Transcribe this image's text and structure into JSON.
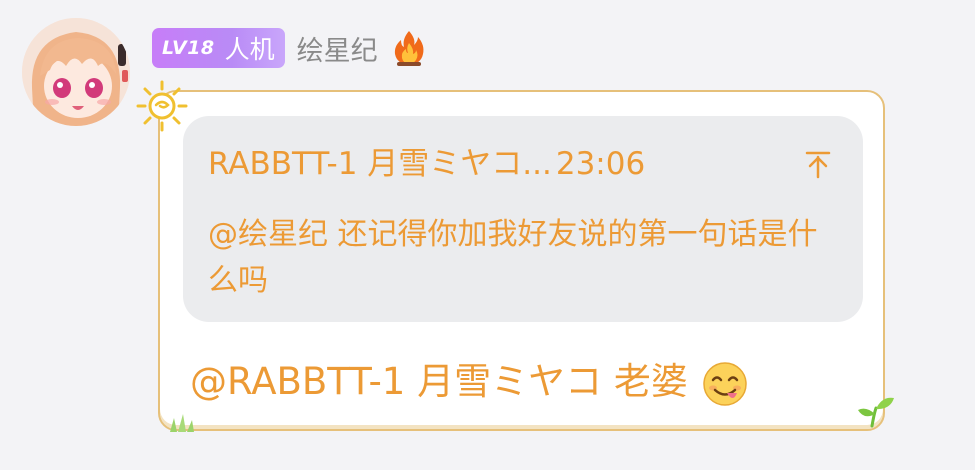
{
  "sender": {
    "level": "LV18",
    "role_badge": "人机",
    "nickname": "绘星纪",
    "flame_emoji": "🔥"
  },
  "reply_quote": {
    "author": "RABBTT-1 月雪ミヤコ...",
    "time": "23:06",
    "text": "@绘星纪 还记得你加我好友说的第一句话是什么吗",
    "jump_icon": "arrow-up-to-top-icon"
  },
  "message": {
    "text": "@RABBTT-1 月雪ミヤコ 老婆",
    "emoji": "yum-face-icon"
  },
  "colors": {
    "accent": "#ec9a35",
    "badge_gradient_start": "#c77df8",
    "bubble_border": "#e6c07a",
    "quote_bg": "#ebecee"
  }
}
